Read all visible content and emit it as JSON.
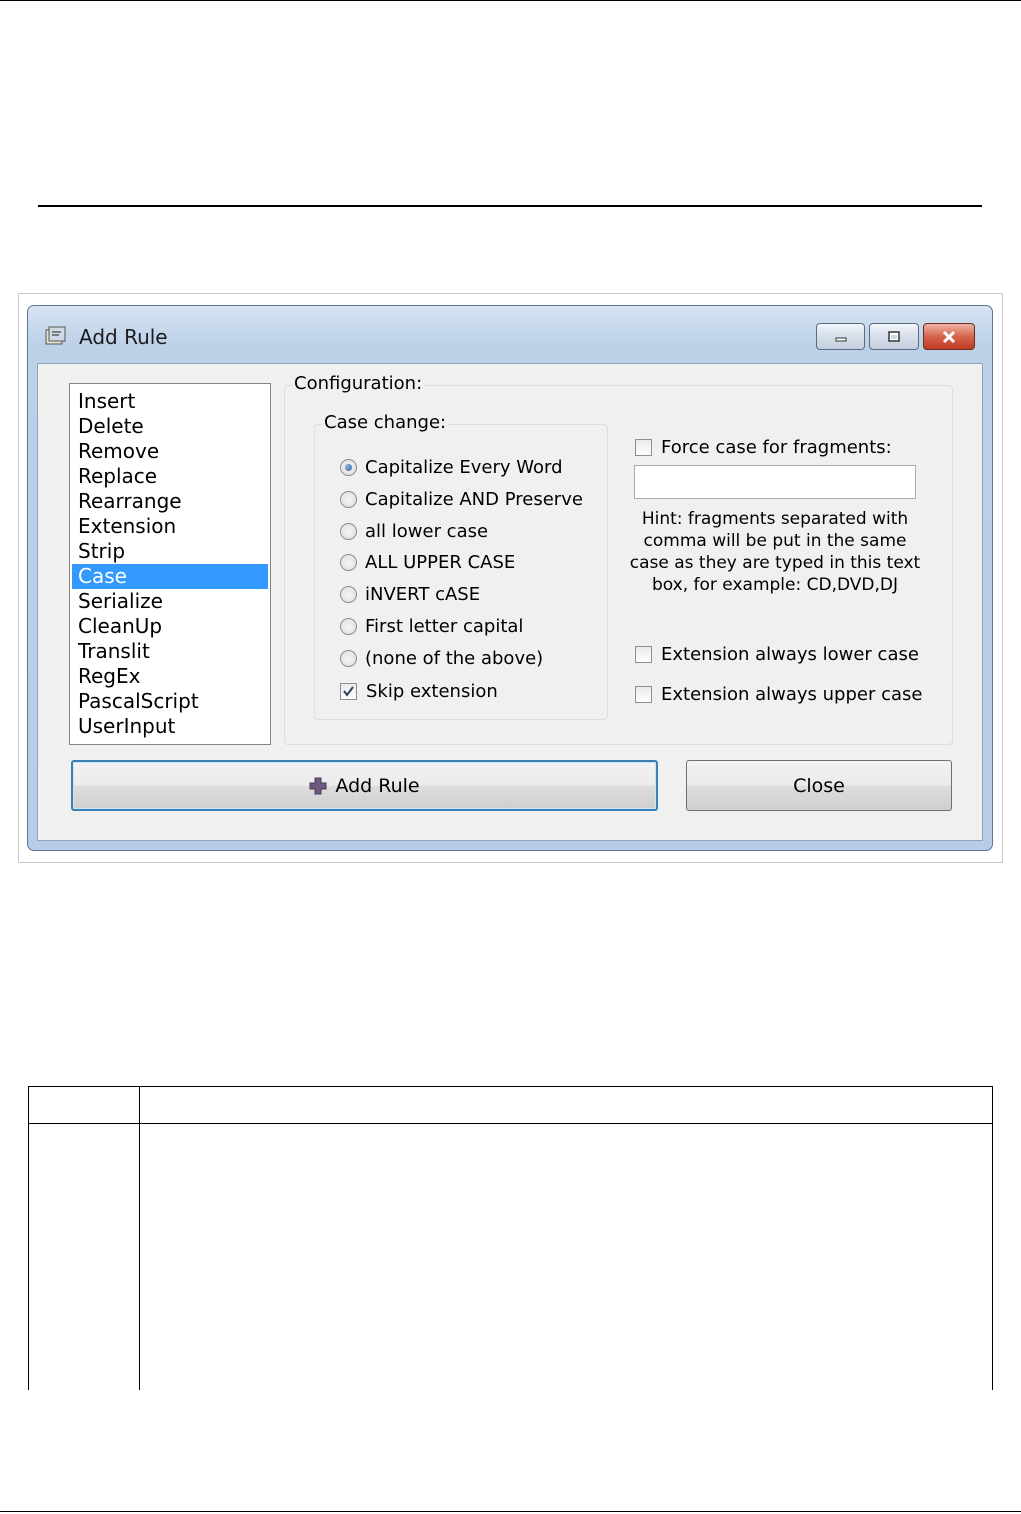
{
  "window": {
    "title": "Add Rule"
  },
  "rule_list": {
    "items": [
      "Insert",
      "Delete",
      "Remove",
      "Replace",
      "Rearrange",
      "Extension",
      "Strip",
      "Case",
      "Serialize",
      "CleanUp",
      "Translit",
      "RegEx",
      "PascalScript",
      "UserInput"
    ],
    "selected": "Case"
  },
  "configuration": {
    "label": "Configuration:",
    "case_change": {
      "label": "Case change:",
      "options": [
        "Capitalize Every Word",
        "Capitalize AND Preserve",
        "all lower case",
        "ALL UPPER CASE",
        "iNVERT cASE",
        "First letter capital",
        "(none of the above)"
      ],
      "selected": "Capitalize Every Word",
      "skip_extension": {
        "label": "Skip extension",
        "checked": true
      }
    },
    "force_case": {
      "label": "Force case for fragments:",
      "checked": false,
      "value": ""
    },
    "hint": "Hint: fragments separated with comma will be put in the same case as they are typed in this text box, for example: CD,DVD,DJ",
    "ext_lower": {
      "label": "Extension always lower case",
      "checked": false
    },
    "ext_upper": {
      "label": "Extension always upper case",
      "checked": false
    }
  },
  "buttons": {
    "add_rule": "Add Rule",
    "close": "Close"
  },
  "colors": {
    "selection": "#3399ff",
    "title_bar": "#bcd0e8",
    "close_button": "#c23a22"
  }
}
